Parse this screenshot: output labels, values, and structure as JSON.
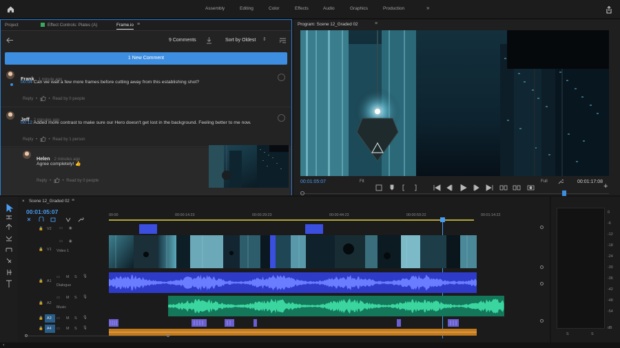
{
  "topbar": {
    "workspaces": [
      "Assembly",
      "Editing",
      "Color",
      "Effects",
      "Audio",
      "Graphics",
      "Production"
    ],
    "more": "»"
  },
  "panel_tabs": {
    "project": "Project",
    "effect_controls": "Effect Controls: Plates (A)",
    "frameio": "Frame.io"
  },
  "comments_toolbar": {
    "count": "9 Comments",
    "sort": "Sort by Oldest"
  },
  "new_comment": "1 New Comment",
  "comments": [
    {
      "author": "Frank",
      "time": "1 minute ago",
      "timecode": "00:04",
      "text": "Can we wait a few more frames before cutting away from this establishing shot?",
      "reply": "Reply",
      "read": "Read by 0 people"
    },
    {
      "author": "Jeff",
      "time": "2 minutes ago",
      "timecode": "00:12",
      "text": "Added more contrast to make sure our Hero doesn't get lost in the background. Feeling better to me now.",
      "reply": "Reply",
      "read": "Read by 1 person"
    },
    {
      "author": "Helen",
      "time": "2 minutes ago",
      "text": "Agree completely! 👍",
      "reply": "Reply",
      "read": "Read by 0 people"
    }
  ],
  "program": {
    "title": "Program: Scene 12_Graded 02",
    "timecode_in": "00:01:05:07",
    "fit": "Fit",
    "quality": "Full",
    "timecode_total": "00:01:17:08",
    "playhead_fraction": 0.86
  },
  "timeline": {
    "sequence": "Scene 12_Graded 02",
    "timecode": "00:01:05:07",
    "ruler": [
      "00:00",
      "00:00:14:23",
      "00:00:29:23",
      "00:00:44:23",
      "00:00:59:22",
      "00:01:14:22"
    ],
    "tracks": {
      "v2": "V2",
      "v1": "V1",
      "video1": "Video 1",
      "a1": "A1",
      "dialogue": "Dialogue",
      "a2": "A2",
      "music": "Music",
      "a3": "A3",
      "a4": "A4"
    },
    "track_buttons": {
      "m": "M",
      "s": "S"
    }
  },
  "meter": {
    "scale": [
      "0",
      "-6",
      "-12",
      "-18",
      "-24",
      "-30",
      "-36",
      "-42",
      "-48",
      "-54",
      "dB"
    ],
    "channels": [
      "S",
      "S"
    ]
  },
  "colors": {
    "accent": "#3d8de0",
    "video_clip": "#3a5fd9",
    "dialogue": "#3746d8",
    "music": "#1f9a6a",
    "a4": "#d08a2a",
    "selection": "#2d7fd6"
  }
}
